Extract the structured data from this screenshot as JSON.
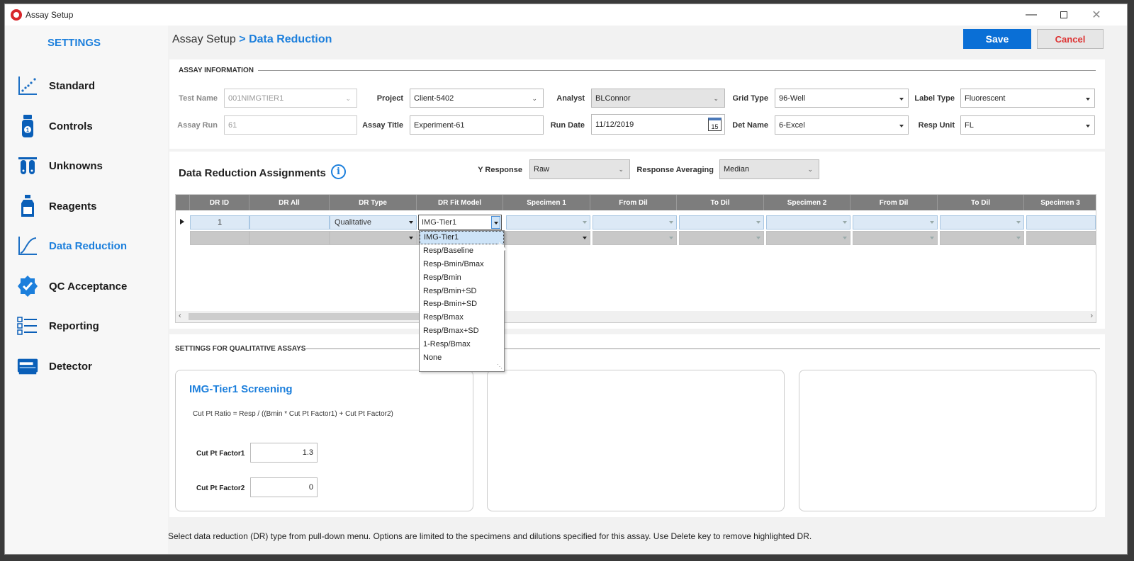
{
  "window": {
    "title": "Assay Setup"
  },
  "sidebar": {
    "heading": "SETTINGS",
    "items": [
      {
        "label": "Standard",
        "icon": "scatter-chart-icon"
      },
      {
        "label": "Controls",
        "icon": "vial-icon"
      },
      {
        "label": "Unknowns",
        "icon": "test-tubes-icon"
      },
      {
        "label": "Reagents",
        "icon": "bottle-icon"
      },
      {
        "label": "Data Reduction",
        "icon": "curve-chart-icon"
      },
      {
        "label": "QC Acceptance",
        "icon": "check-badge-icon"
      },
      {
        "label": "Reporting",
        "icon": "checklist-icon"
      },
      {
        "label": "Detector",
        "icon": "plate-reader-icon"
      }
    ],
    "active": "Data Reduction"
  },
  "header": {
    "crumb_root": "Assay Setup",
    "crumb_current": "> Data Reduction",
    "save_label": "Save",
    "cancel_label": "Cancel"
  },
  "assay_info": {
    "section_title": "ASSAY INFORMATION",
    "test_name_label": "Test Name",
    "test_name": "001NIMGTIER1",
    "assay_run_label": "Assay Run",
    "assay_run": "61",
    "project_label": "Project",
    "project": "Client-5402",
    "assay_title_label": "Assay Title",
    "assay_title": "Experiment-61",
    "analyst_label": "Analyst",
    "analyst": "BLConnor",
    "run_date_label": "Run Date",
    "run_date": "11/12/2019",
    "calendar_day": "15",
    "grid_type_label": "Grid Type",
    "grid_type": "96-Well",
    "det_name_label": "Det Name",
    "det_name": "6-Excel",
    "label_type_label": "Label Type",
    "label_type": "Fluorescent",
    "resp_unit_label": "Resp Unit",
    "resp_unit": "FL"
  },
  "dr_assignments": {
    "title": "Data Reduction Assignments",
    "y_response_label": "Y Response",
    "y_response": "Raw",
    "resp_avg_label": "Response Averaging",
    "resp_avg": "Median",
    "columns": [
      "DR ID",
      "DR All",
      "DR Type",
      "DR Fit Model",
      "Specimen 1",
      "From Dil",
      "To Dil",
      "Specimen 2",
      "From Dil",
      "To Dil",
      "Specimen 3"
    ],
    "row1": {
      "dr_id": "1",
      "dr_type": "Qualitative",
      "fit_model": "IMG-Tier1"
    },
    "fit_model_options": [
      "IMG-Tier1",
      "Resp/Baseline",
      "Resp-Bmin/Bmax",
      "Resp/Bmin",
      "Resp/Bmin+SD",
      "Resp-Bmin+SD",
      "Resp/Bmax",
      "Resp/Bmax+SD",
      "1-Resp/Bmax",
      "None"
    ]
  },
  "qualitative": {
    "section_title": "SETTINGS FOR QUALITATIVE ASSAYS",
    "card_title": "IMG-Tier1 Screening",
    "formula": "Cut Pt Ratio = Resp / ((Bmin * Cut Pt Factor1) + Cut Pt Factor2)",
    "factor1_label": "Cut Pt Factor1",
    "factor1": "1.3",
    "factor2_label": "Cut Pt Factor2",
    "factor2": "0"
  },
  "footer": {
    "hint": "Select data reduction (DR) type from pull-down menu.  Options are limited to the specimens and dilutions specified for this assay. Use Delete key to remove highlighted DR."
  },
  "colors": {
    "accent": "#1c7fdc",
    "save": "#0a6fd6",
    "cancel_text": "#dd3333",
    "grid_header": "#7d7d7d"
  }
}
